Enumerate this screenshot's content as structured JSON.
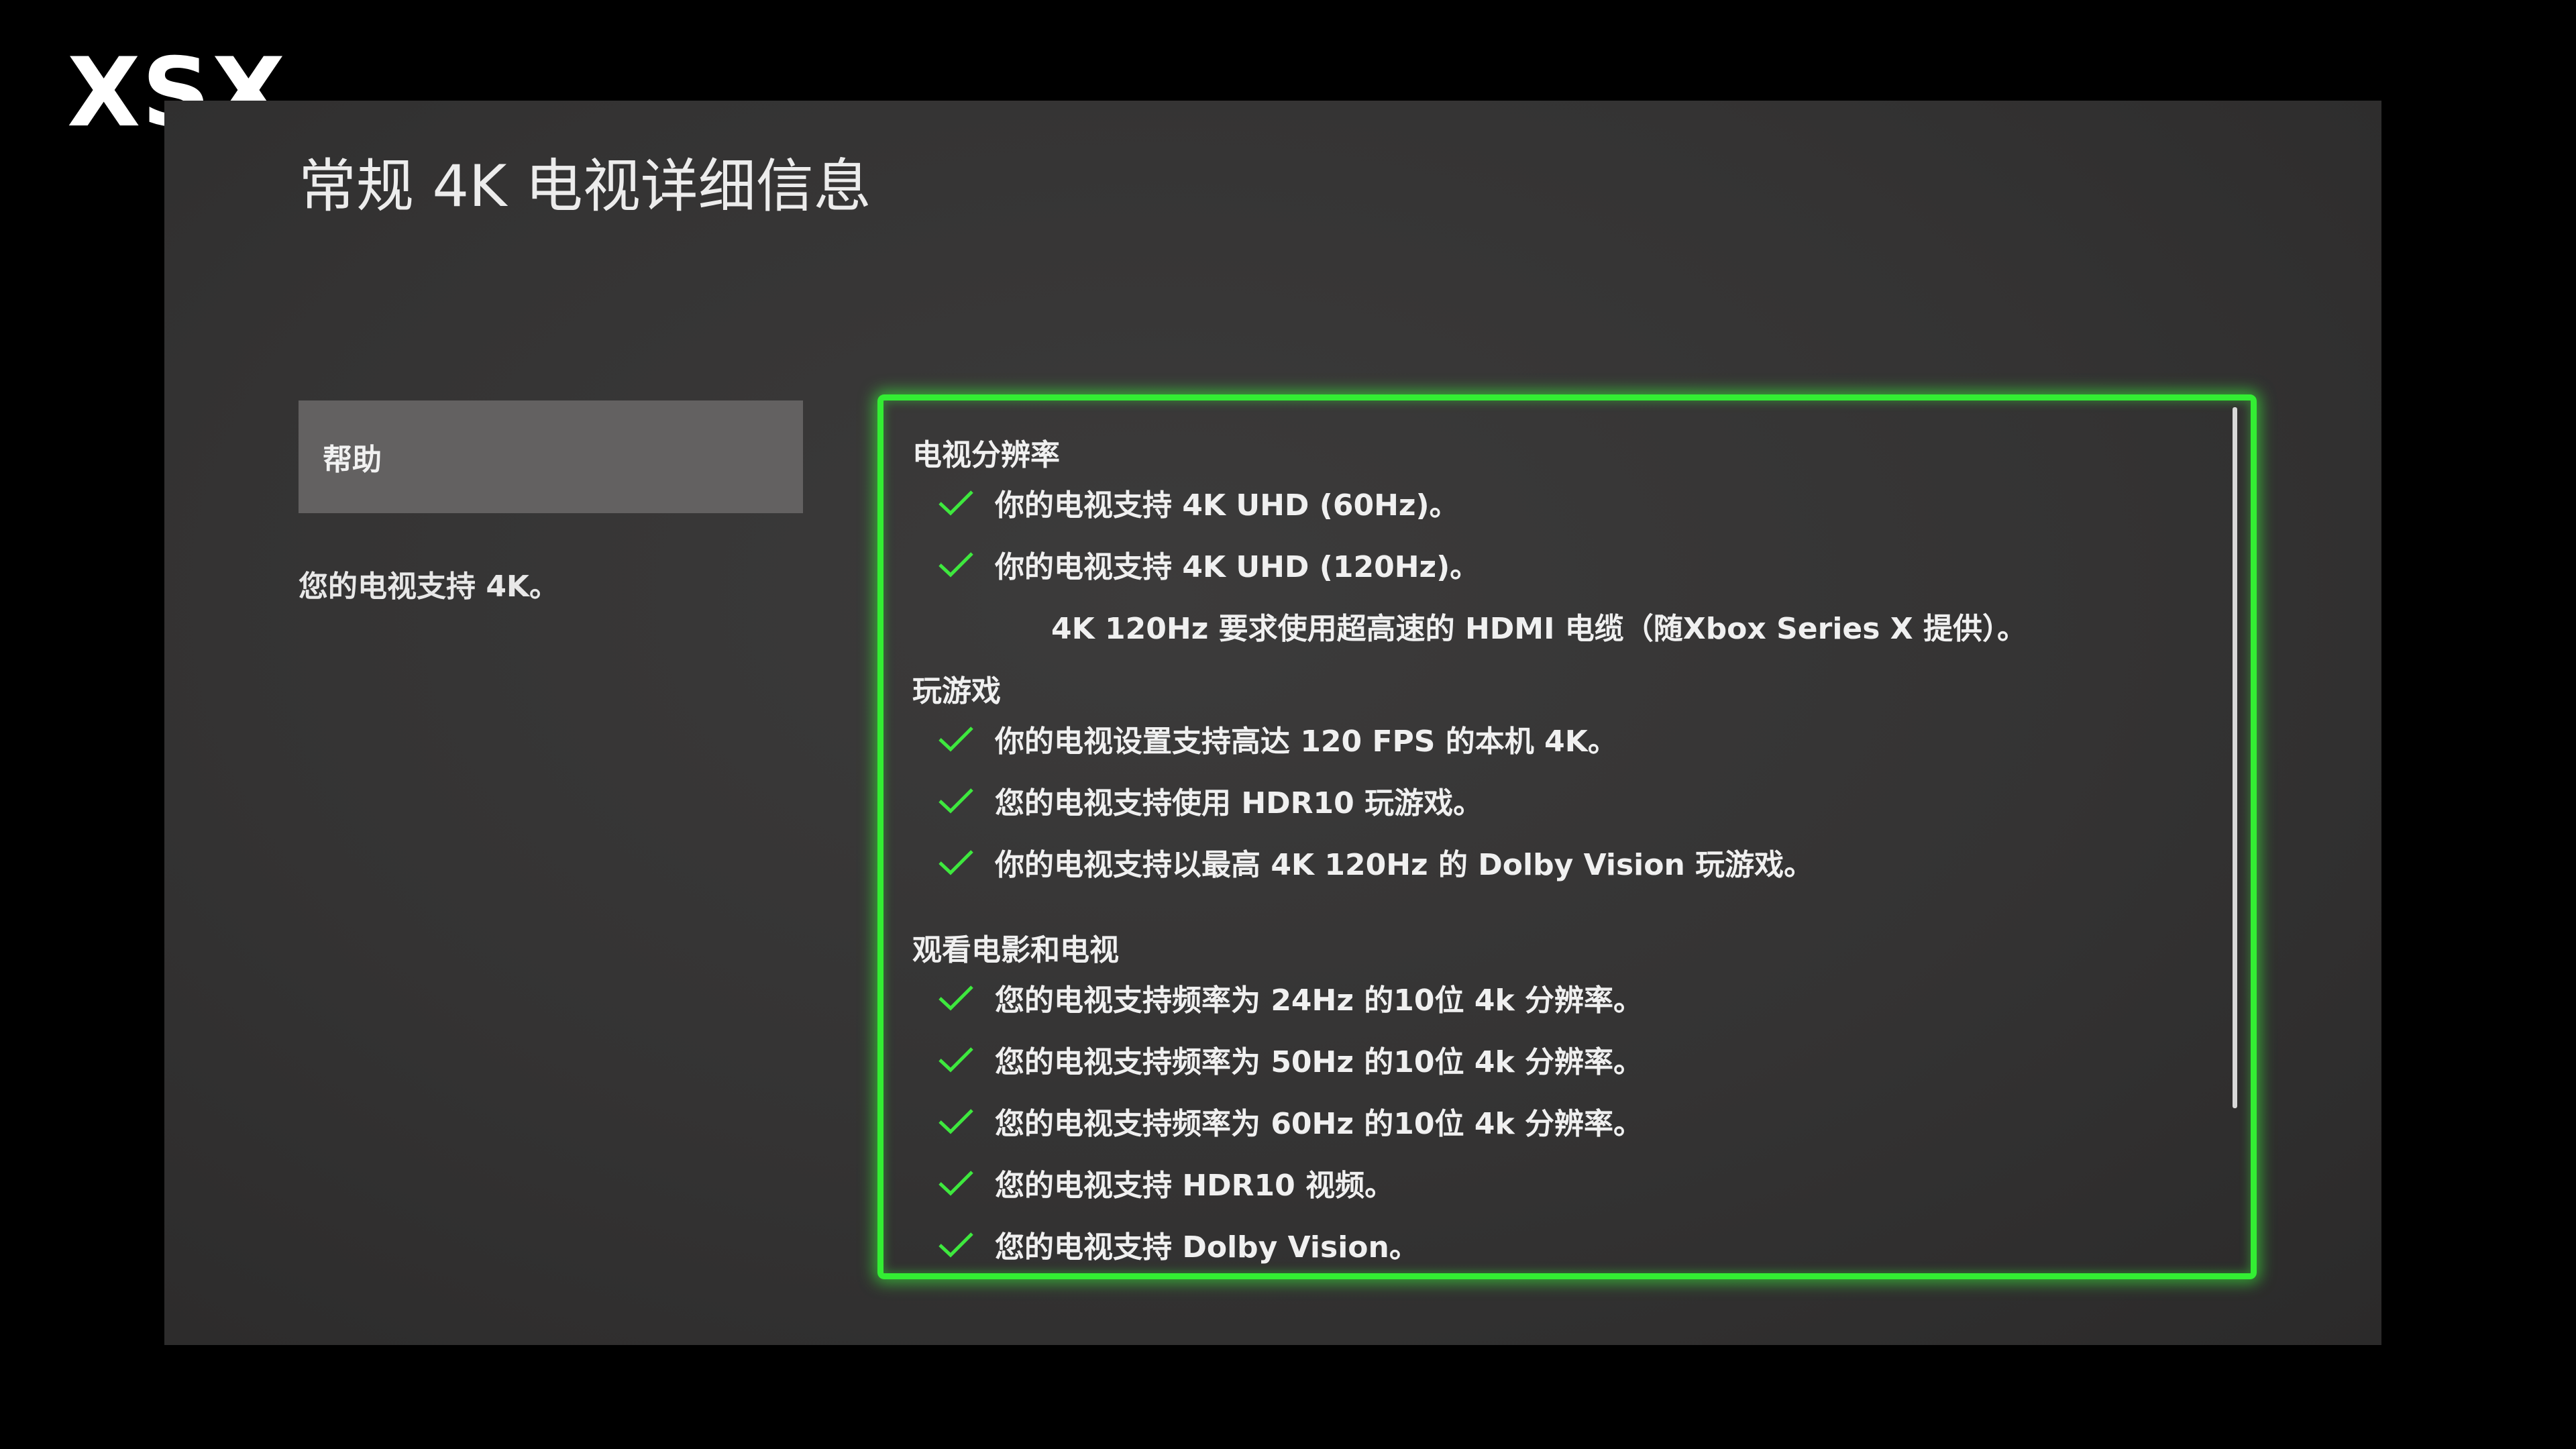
{
  "watermark": "XSX",
  "page": {
    "title": "常规 4K 电视详细信息",
    "help_label": "帮助",
    "summary": "您的电视支持 4K。"
  },
  "details": {
    "resolution": {
      "title": "电视分辨率",
      "items": [
        "你的电视支持 4K UHD (60Hz)。",
        "你的电视支持 4K UHD (120Hz)。"
      ],
      "note": "4K 120Hz 要求使用超高速的 HDMI 电缆（随Xbox Series X 提供）。"
    },
    "gaming": {
      "title": "玩游戏",
      "items": [
        "你的电视设置支持高达 120 FPS 的本机 4K。",
        "您的电视支持使用 HDR10 玩游戏。",
        "你的电视支持以最高 4K 120Hz 的 Dolby Vision 玩游戏。"
      ]
    },
    "movies": {
      "title": "观看电影和电视",
      "items": [
        "您的电视支持频率为 24Hz 的10位 4k 分辨率。",
        "您的电视支持频率为 50Hz 的10位 4k 分辨率。",
        "您的电视支持频率为 60Hz 的10位 4k 分辨率。",
        "您的电视支持 HDR10 视频。",
        "您的电视支持 Dolby Vision。"
      ]
    }
  },
  "icons": {
    "check": "check-icon"
  },
  "colors": {
    "focus_border": "#33ee33",
    "check": "#3ee83e",
    "screen_bg": "#363535",
    "button_bg": "#636161",
    "text": "#f0f0f0"
  }
}
